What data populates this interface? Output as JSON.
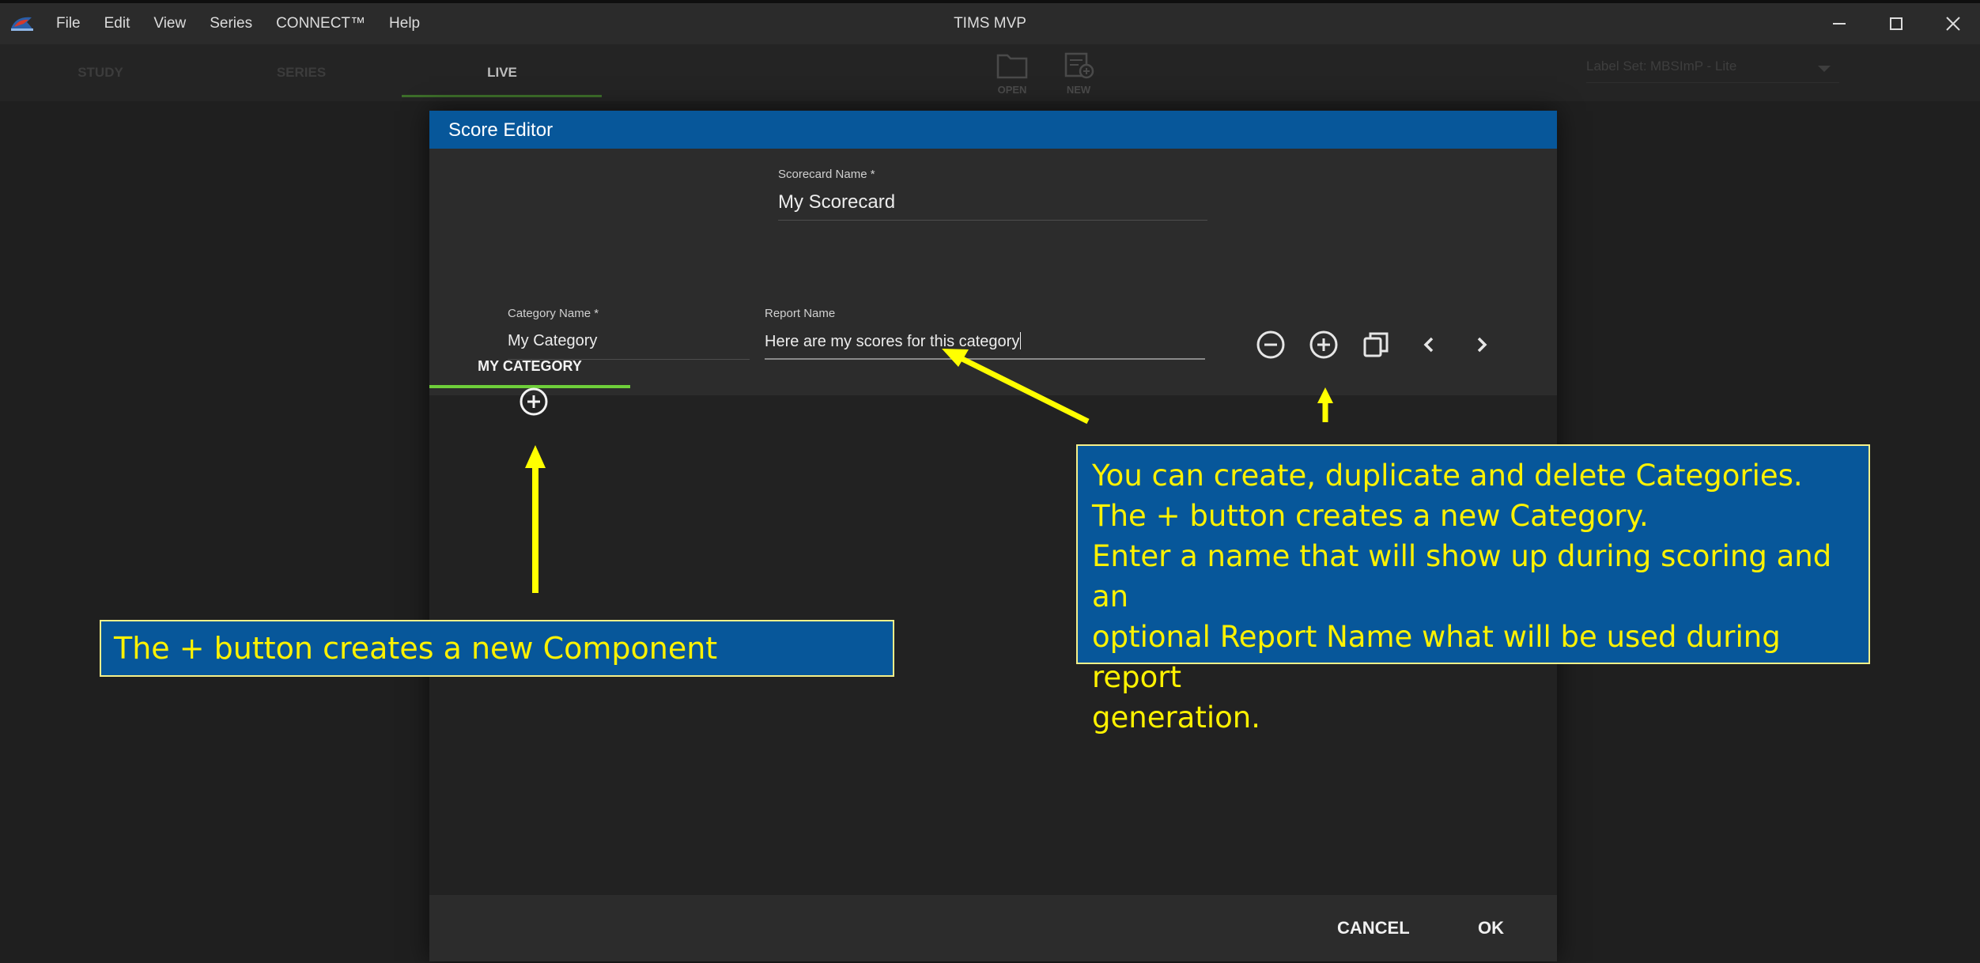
{
  "window": {
    "title": "TIMS MVP",
    "menu": [
      "File",
      "Edit",
      "View",
      "Series",
      "CONNECT™",
      "Help"
    ]
  },
  "toolbar": {
    "tabs": [
      "STUDY",
      "SERIES",
      "LIVE"
    ],
    "active_tab": "LIVE",
    "open_label": "OPEN",
    "new_label": "NEW",
    "label_set_prefix": "Label Set:",
    "label_set_value": "MBSImP - Lite"
  },
  "dialog": {
    "title": "Score Editor",
    "scorecard_name_label": "Scorecard Name *",
    "scorecard_name_value": "My Scorecard",
    "category_tab": "MY CATEGORY",
    "category_name_label": "Category Name *",
    "category_name_value": "My Category",
    "report_name_label": "Report Name",
    "report_name_value": "Here are my scores for this category",
    "cancel_label": "CANCEL",
    "ok_label": "OK"
  },
  "callouts": {
    "component": "The + button creates a new Component",
    "category_lines": [
      "You can create, duplicate and delete Categories.",
      "The + button creates a new Category.",
      "Enter a name that will show up during scoring and an",
      "optional Report Name what will be used during report",
      "generation."
    ]
  },
  "colors": {
    "dialog_header": "#07579a",
    "accent_tab": "#6fcf3a",
    "callout_text": "#fff200",
    "arrow": "#ffff00"
  },
  "icons": [
    "app-logo-icon",
    "minimize-icon",
    "maximize-icon",
    "close-icon",
    "folder-open-icon",
    "new-study-icon",
    "dropdown-arrow-icon",
    "remove-category-icon",
    "add-category-icon",
    "duplicate-category-icon",
    "chevron-left-icon",
    "chevron-right-icon",
    "add-component-icon"
  ]
}
